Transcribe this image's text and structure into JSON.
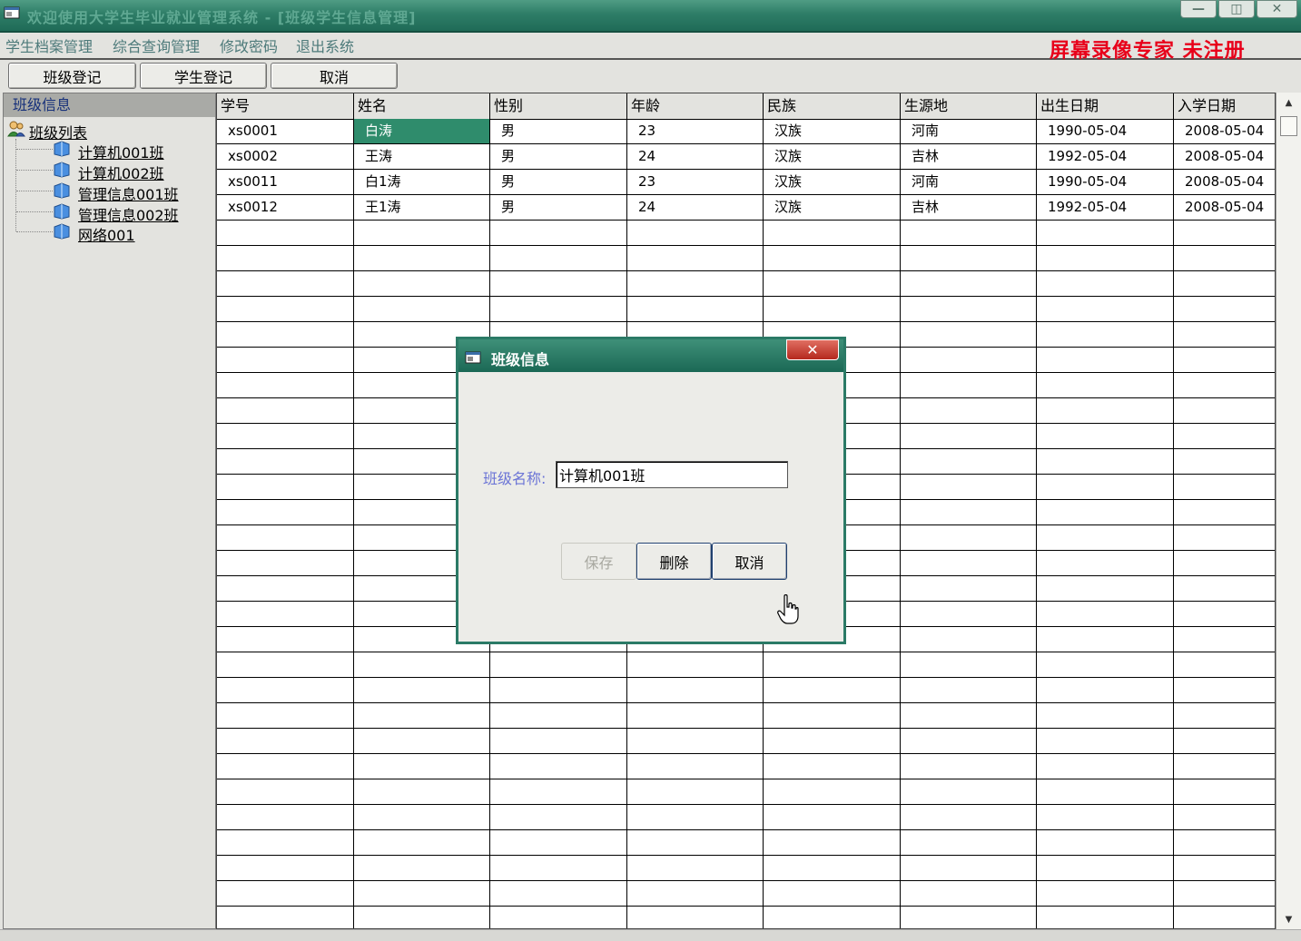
{
  "window": {
    "title": "欢迎使用大学生毕业就业管理系统 - [班级学生信息管理]",
    "controls": {
      "minimize": "—",
      "maximize": "◫",
      "close": "✕"
    }
  },
  "menu": {
    "items": [
      "学生档案管理",
      "综合查询管理",
      "修改密码",
      "退出系统"
    ],
    "watermark": "屏幕录像专家  未注册"
  },
  "toolbar": {
    "buttons": [
      "班级登记",
      "学生登记",
      "取消"
    ]
  },
  "tree": {
    "header": "班级信息",
    "root": "班级列表",
    "items": [
      "计算机001班",
      "计算机002班",
      "管理信息001班",
      "管理信息002班",
      "网络001"
    ]
  },
  "grid": {
    "columns": [
      "学号",
      "姓名",
      "性别",
      "年龄",
      "民族",
      "生源地",
      "出生日期",
      "入学日期"
    ],
    "rows": [
      [
        "xs0001",
        "白涛",
        "男",
        "23",
        "汉族",
        "河南",
        "1990-05-04",
        "2008-05-04"
      ],
      [
        "xs0002",
        "王涛",
        "男",
        "24",
        "汉族",
        "吉林",
        "1992-05-04",
        "2008-05-04"
      ],
      [
        "xs0011",
        "白1涛",
        "男",
        "23",
        "汉族",
        "河南",
        "1990-05-04",
        "2008-05-04"
      ],
      [
        "xs0012",
        "王1涛",
        "男",
        "24",
        "汉族",
        "吉林",
        "1992-05-04",
        "2008-05-04"
      ]
    ],
    "selected_cell": {
      "row": 0,
      "column": 1
    }
  },
  "dialog": {
    "title": "班级信息",
    "close_glyph": "✕",
    "field_label": "班级名称:",
    "field_value": "计算机001班",
    "buttons": {
      "save": "保存",
      "delete": "删除",
      "cancel": "取消"
    },
    "save_disabled": true
  },
  "scrollbar": {
    "up": "▲",
    "down": "▼"
  },
  "colors": {
    "titlebar": "#2e7d67",
    "selected_cell": "#2f8c6c",
    "watermark": "#e8001a",
    "dialog_border": "#2b7a66",
    "close_button": "#c9382b"
  }
}
